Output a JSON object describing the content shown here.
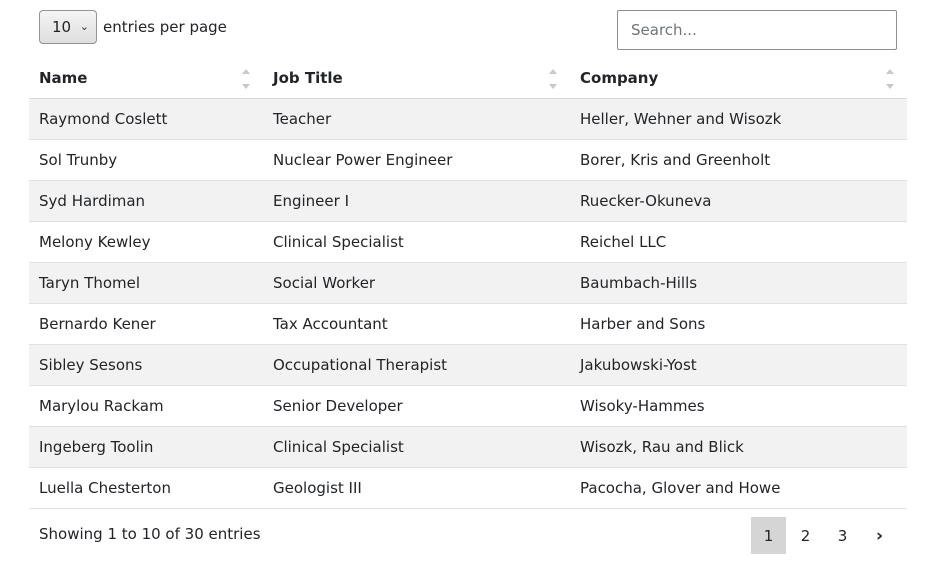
{
  "controls": {
    "per_page_value": "10",
    "per_page_label": "entries per page",
    "search_placeholder": "Search..."
  },
  "table": {
    "columns": [
      "Name",
      "Job Title",
      "Company"
    ],
    "rows": [
      [
        "Raymond Coslett",
        "Teacher",
        "Heller, Wehner and Wisozk"
      ],
      [
        "Sol Trunby",
        "Nuclear Power Engineer",
        "Borer, Kris and Greenholt"
      ],
      [
        "Syd Hardiman",
        "Engineer I",
        "Ruecker-Okuneva"
      ],
      [
        "Melony Kewley",
        "Clinical Specialist",
        "Reichel LLC"
      ],
      [
        "Taryn Thomel",
        "Social Worker",
        "Baumbach-Hills"
      ],
      [
        "Bernardo Kener",
        "Tax Accountant",
        "Harber and Sons"
      ],
      [
        "Sibley Sesons",
        "Occupational Therapist",
        "Jakubowski-Yost"
      ],
      [
        "Marylou Rackam",
        "Senior Developer",
        "Wisoky-Hammes"
      ],
      [
        "Ingeberg Toolin",
        "Clinical Specialist",
        "Wisozk, Rau and Blick"
      ],
      [
        "Luella Chesterton",
        "Geologist III",
        "Pacocha, Glover and Howe"
      ]
    ]
  },
  "footer": {
    "info": "Showing 1 to 10 of 30 entries",
    "pages": [
      "1",
      "2",
      "3"
    ],
    "current_page": "1",
    "next": "›"
  }
}
